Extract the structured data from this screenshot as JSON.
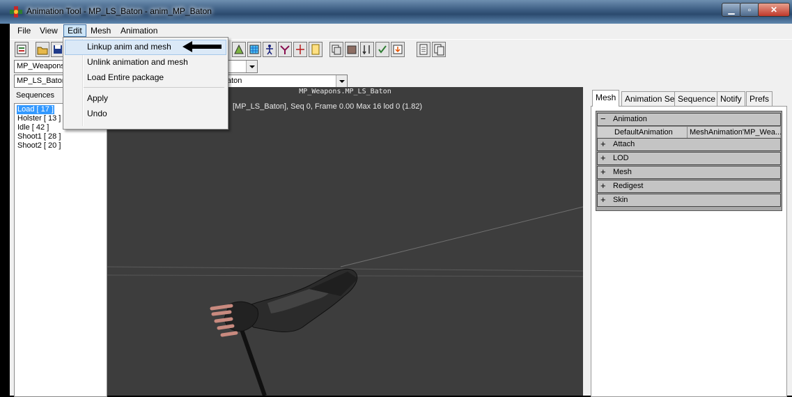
{
  "window": {
    "title": "Animation Tool - MP_LS_Baton  - anim_MP_Baton"
  },
  "menubar": {
    "file": "File",
    "view": "View",
    "edit": "Edit",
    "mesh": "Mesh",
    "animation": "Animation"
  },
  "edit_menu": {
    "items": [
      "Linkup anim and mesh",
      "Unlink animation and mesh",
      "Load Entire package",
      "Apply",
      "Undo"
    ]
  },
  "combos": {
    "package": "MP_Weapons",
    "mesh": "MP_LS_Baton",
    "mesh_right": "aton"
  },
  "sequences": {
    "label": "Sequences",
    "items": [
      "Load [ 17 ]",
      "Holster [ 13 ]",
      "Idle [ 42 ]",
      "Shoot1 [ 28 ]",
      "Shoot2 [ 20 ]"
    ]
  },
  "viewport": {
    "title": "MP_Weapons.MP_LS_Baton",
    "info": "[MP_LS_Baton], Seq 0,  Frame  0.00 Max 16  lod 0 (1.82)"
  },
  "tabs": [
    "Mesh",
    "Animation Set",
    "Sequence",
    "Notify",
    "Prefs"
  ],
  "properties": {
    "animation_group": "Animation",
    "default_animation_label": "DefaultAnimation",
    "default_animation_value": "MeshAnimation'MP_Wea...",
    "groups": [
      "Attach",
      "LOD",
      "Mesh",
      "Redigest",
      "Skin"
    ]
  },
  "symbols": {
    "expanded": "−",
    "collapsed": "+"
  }
}
